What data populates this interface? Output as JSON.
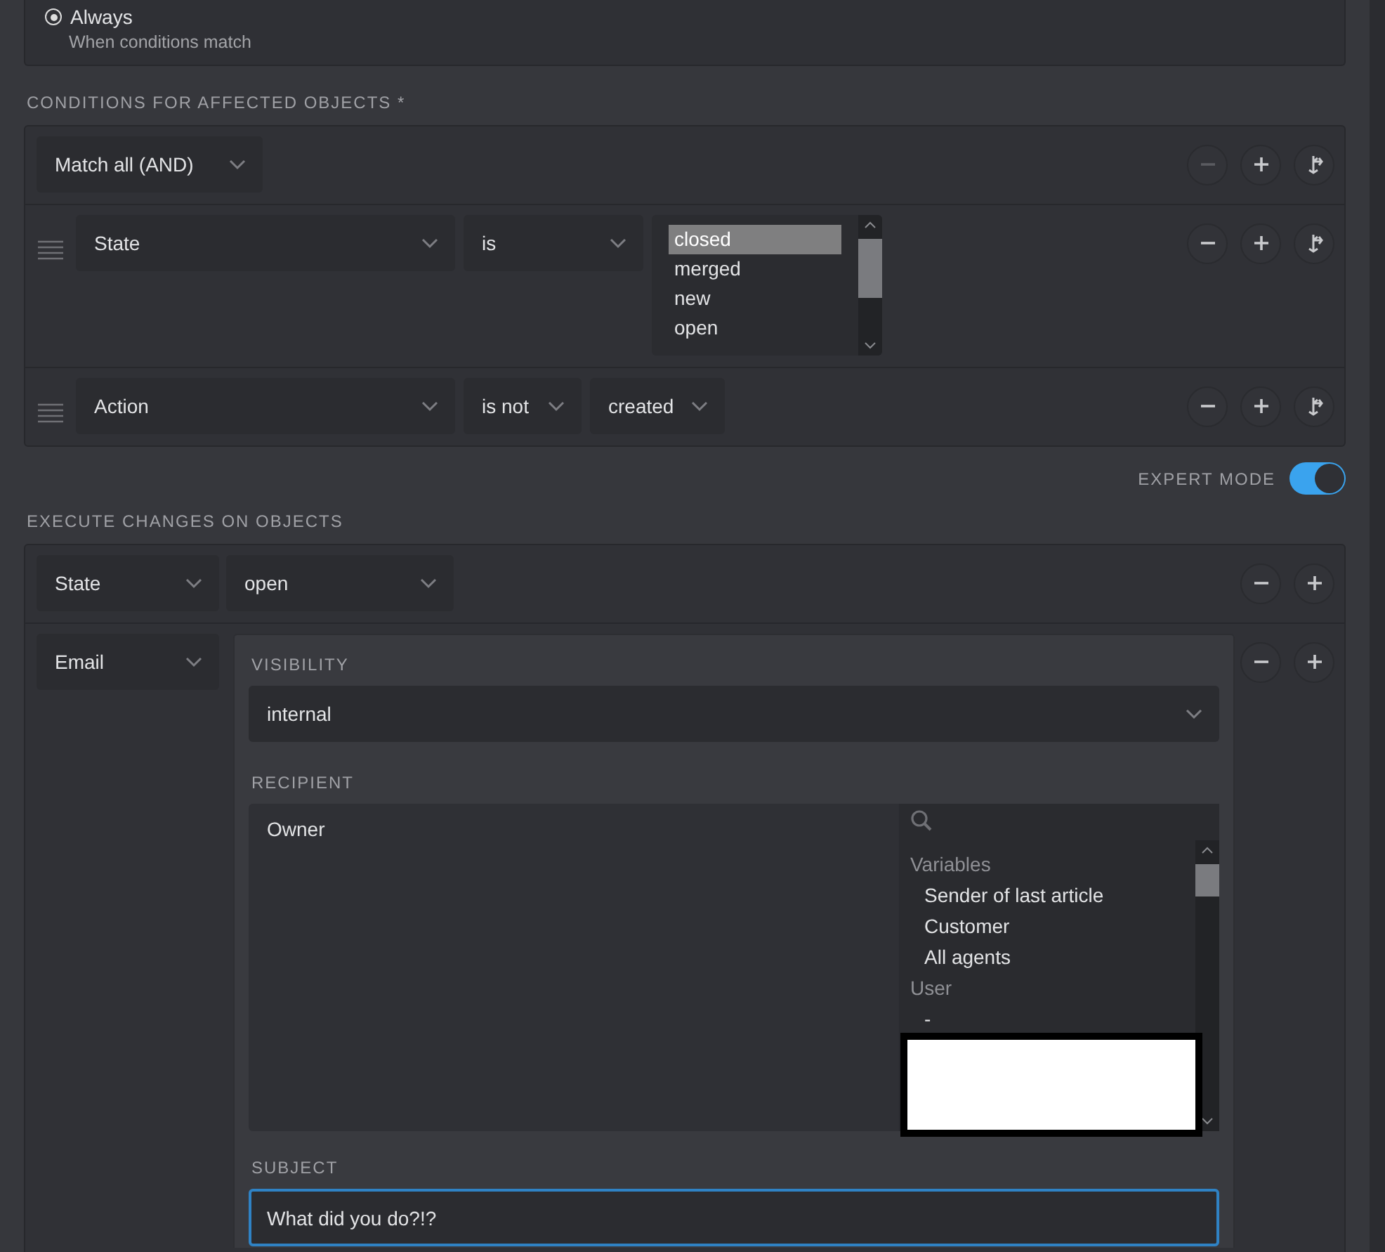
{
  "trigger": {
    "label": "Always",
    "hint": "When conditions match",
    "selected": true
  },
  "conditions": {
    "title": "CONDITIONS FOR AFFECTED OBJECTS *",
    "match": "Match all (AND)",
    "remove_disabled": true,
    "rows": [
      {
        "kind": "list",
        "attribute": "State",
        "operator": "is",
        "remove_disabled": false,
        "options": [
          {
            "label": "closed",
            "selected": true
          },
          {
            "label": "merged",
            "selected": false
          },
          {
            "label": "new",
            "selected": false
          },
          {
            "label": "open",
            "selected": false
          }
        ]
      },
      {
        "kind": "select",
        "attribute": "Action",
        "operator": "is not",
        "value": "created",
        "remove_disabled": false
      }
    ]
  },
  "expert_mode": {
    "label": "EXPERT MODE",
    "on": true
  },
  "execute": {
    "title": "EXECUTE CHANGES ON OBJECTS",
    "rows": [
      {
        "kind": "select",
        "attribute": "State",
        "value": "open"
      },
      {
        "kind": "email",
        "attribute": "Email",
        "visibility_label": "VISIBILITY",
        "visibility": "internal",
        "recipient_label": "RECIPIENT",
        "recipients": [
          "Owner"
        ],
        "groups": [
          {
            "label": "Variables",
            "items": [
              "Sender of last article",
              "Customer",
              "All agents"
            ]
          },
          {
            "label": "User",
            "items": [
              "-"
            ]
          }
        ],
        "subject_label": "SUBJECT",
        "subject": "What did you do?!?"
      }
    ]
  }
}
